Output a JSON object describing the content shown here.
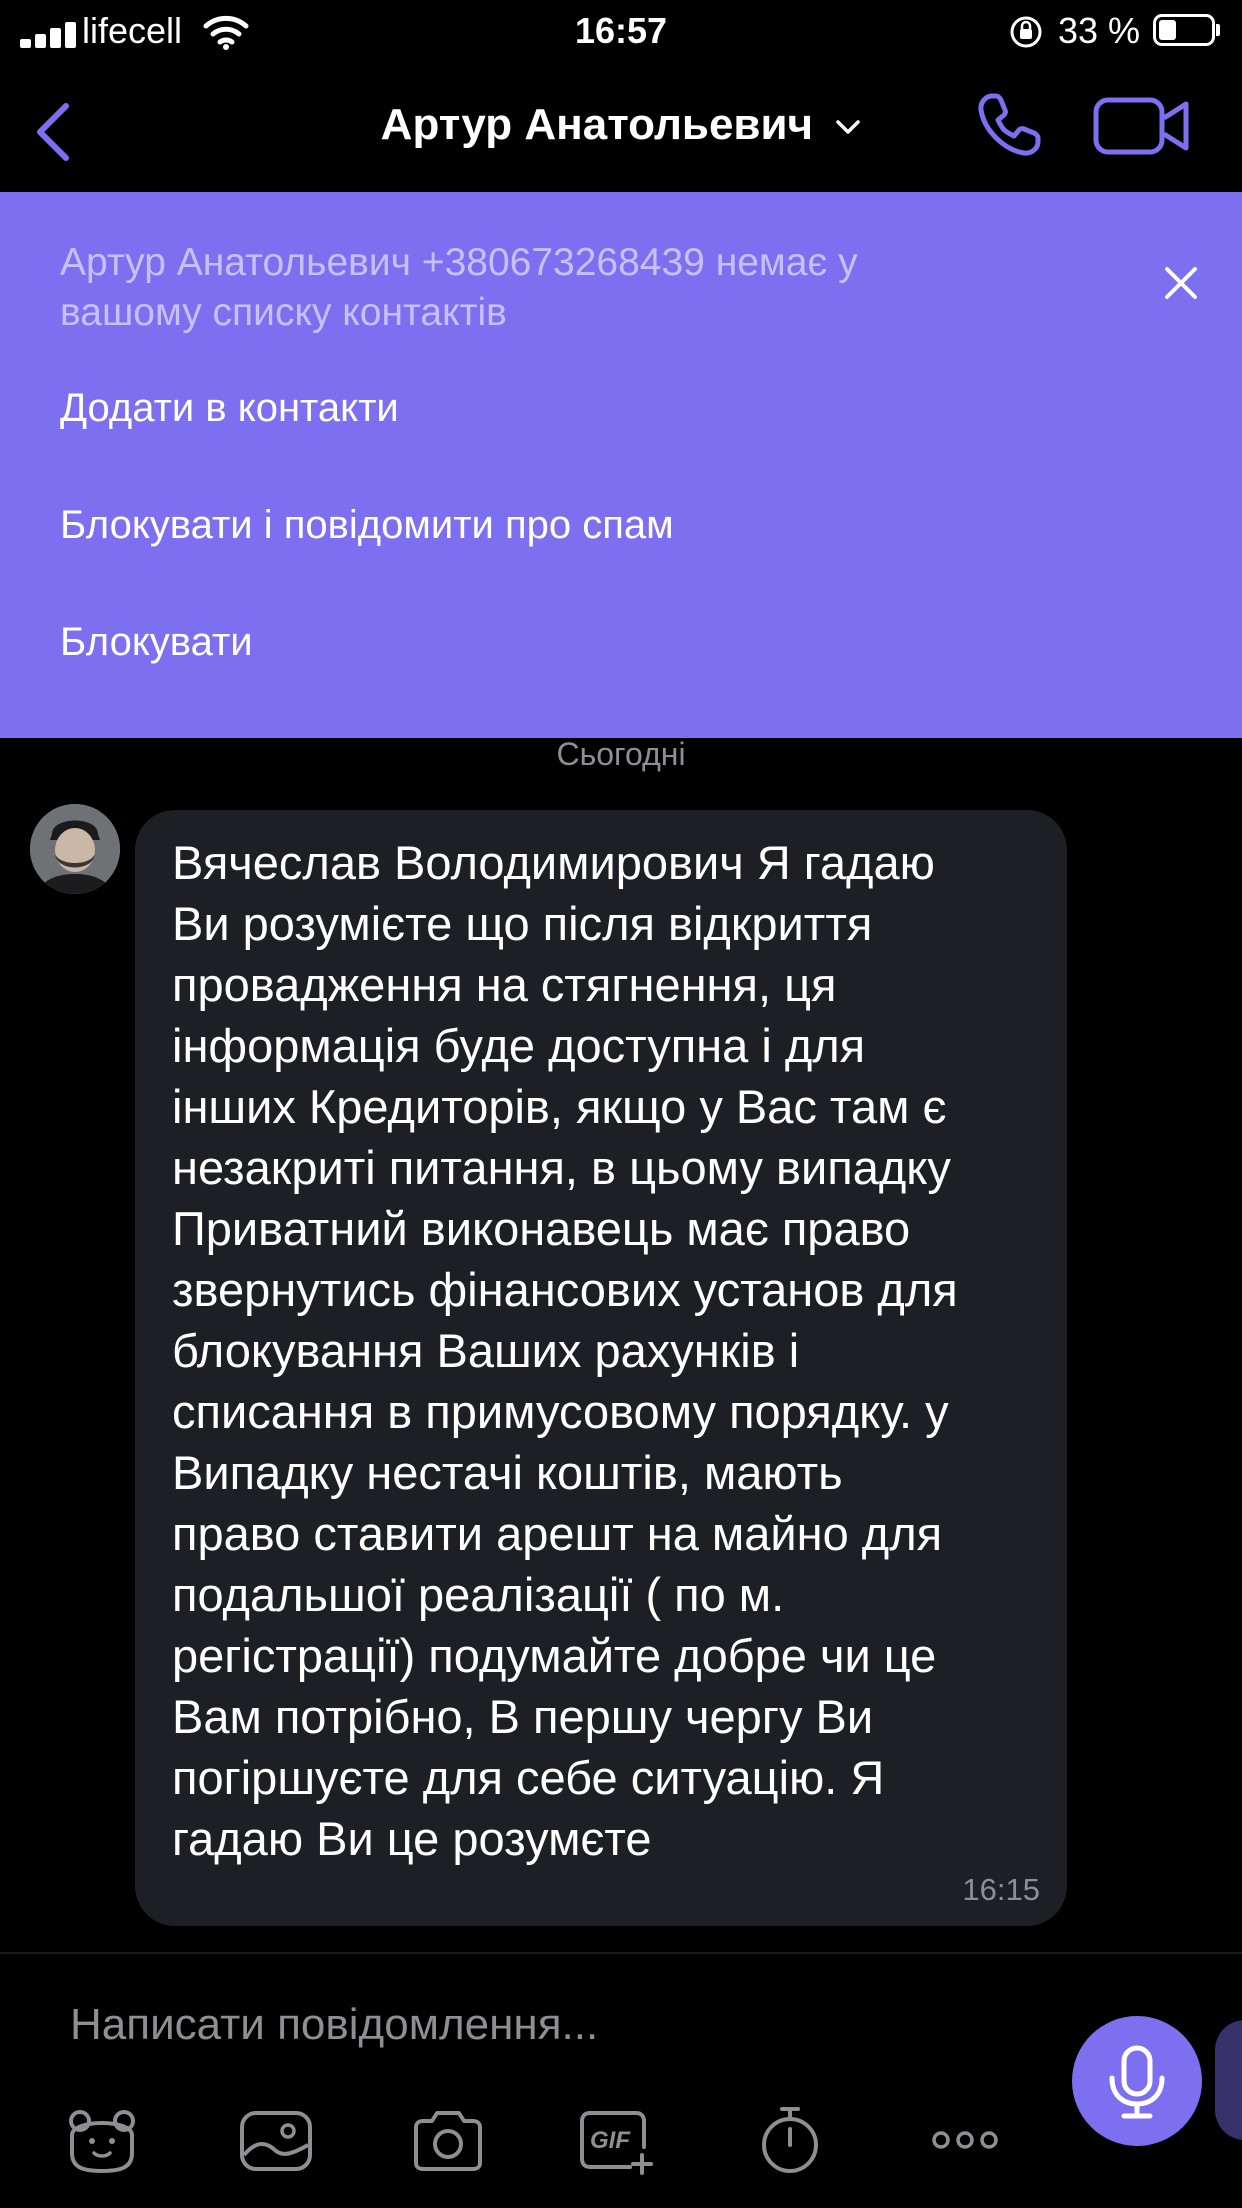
{
  "status_bar": {
    "carrier": "lifecell",
    "time": "16:57",
    "battery_percent": "33 %",
    "battery_level": 0.33
  },
  "header": {
    "contact_name": "Артур Анатольевич",
    "accent_color": "#7c6ff0"
  },
  "banner": {
    "notice": "Артур Анатольевич +380673268439 немає у вашому списку контактів",
    "actions": [
      "Додати в контакти",
      "Блокувати і повідомити про спам",
      "Блокувати"
    ],
    "background": "#7c6ff0"
  },
  "chat": {
    "date_label": "Сьогодні",
    "messages": [
      {
        "text": "Вячеслав Володимирович Я гадаю\nВи розумієте що після відкриття\nпровадження на стягнення,  ця\nінформація буде доступна і для\nінших Кредиторів, якщо у Вас там є\nнезакриті питання, в цьому випадку\nПриватний виконавець має право\nзвернутись фінансових установ для\nблокування Ваших рахунків і\nсписання в примусовому порядку. у\nВипадку нестачі коштів, мають\nправо ставити арешт на майно для\nподальшої реалізації ( по м.\nрегістрації)  подумайте добре чи це\nВам потрібно, В першу чергу Ви\nпогіршуєте для себе ситуацію. Я\nгадаю Ви це розумєте",
        "time": "16:15"
      }
    ]
  },
  "composer": {
    "placeholder": "Написати повідомлення...",
    "toolbar_icons": [
      "sticker-icon",
      "gallery-icon",
      "camera-icon",
      "gif-icon",
      "timer-icon",
      "more-icon"
    ],
    "gif_label": "GIF"
  }
}
